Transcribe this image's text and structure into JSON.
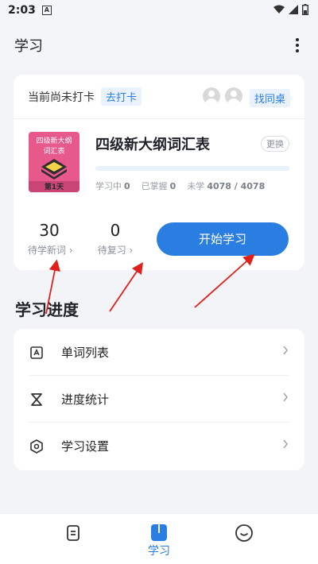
{
  "status_bar": {
    "time": "2:03",
    "badge": "A"
  },
  "header": {
    "title": "学习"
  },
  "study_card": {
    "checkin_status": "当前尚未打卡",
    "checkin_button": "去打卡",
    "find_partner_button": "找同桌",
    "book": {
      "cover_line1": "四级新大纲",
      "cover_line2": "词汇表",
      "cover_day": "第1天",
      "title": "四级新大纲词汇表",
      "change_button": "更换",
      "progress_fraction": 0
    },
    "stats": {
      "learning_label": "学习中",
      "learning_value": "0",
      "mastered_label": "已掌握",
      "mastered_value": "0",
      "unlearned_label": "未学",
      "unlearned_value": "4078 / 4078"
    },
    "new_words_count": "30",
    "new_words_label": "待学新词 ›",
    "review_count": "0",
    "review_label": "待复习 ›",
    "start_button": "开始学习"
  },
  "progress_section": {
    "title": "学习进度",
    "items": [
      {
        "label": "单词列表",
        "icon": "word-list-icon"
      },
      {
        "label": "进度统计",
        "icon": "hourglass-icon"
      },
      {
        "label": "学习设置",
        "icon": "settings-hexagon-icon"
      }
    ]
  },
  "bottom_nav": {
    "items": [
      {
        "icon": "note-icon",
        "label": ""
      },
      {
        "icon": "book-icon",
        "label": "学习"
      },
      {
        "icon": "smile-icon",
        "label": ""
      }
    ],
    "active_index": 1
  },
  "colors": {
    "accent": "#2a7de1",
    "background": "#f2f4f8",
    "cover_pink": "#e7588b",
    "annotation_red": "#e0211b"
  }
}
